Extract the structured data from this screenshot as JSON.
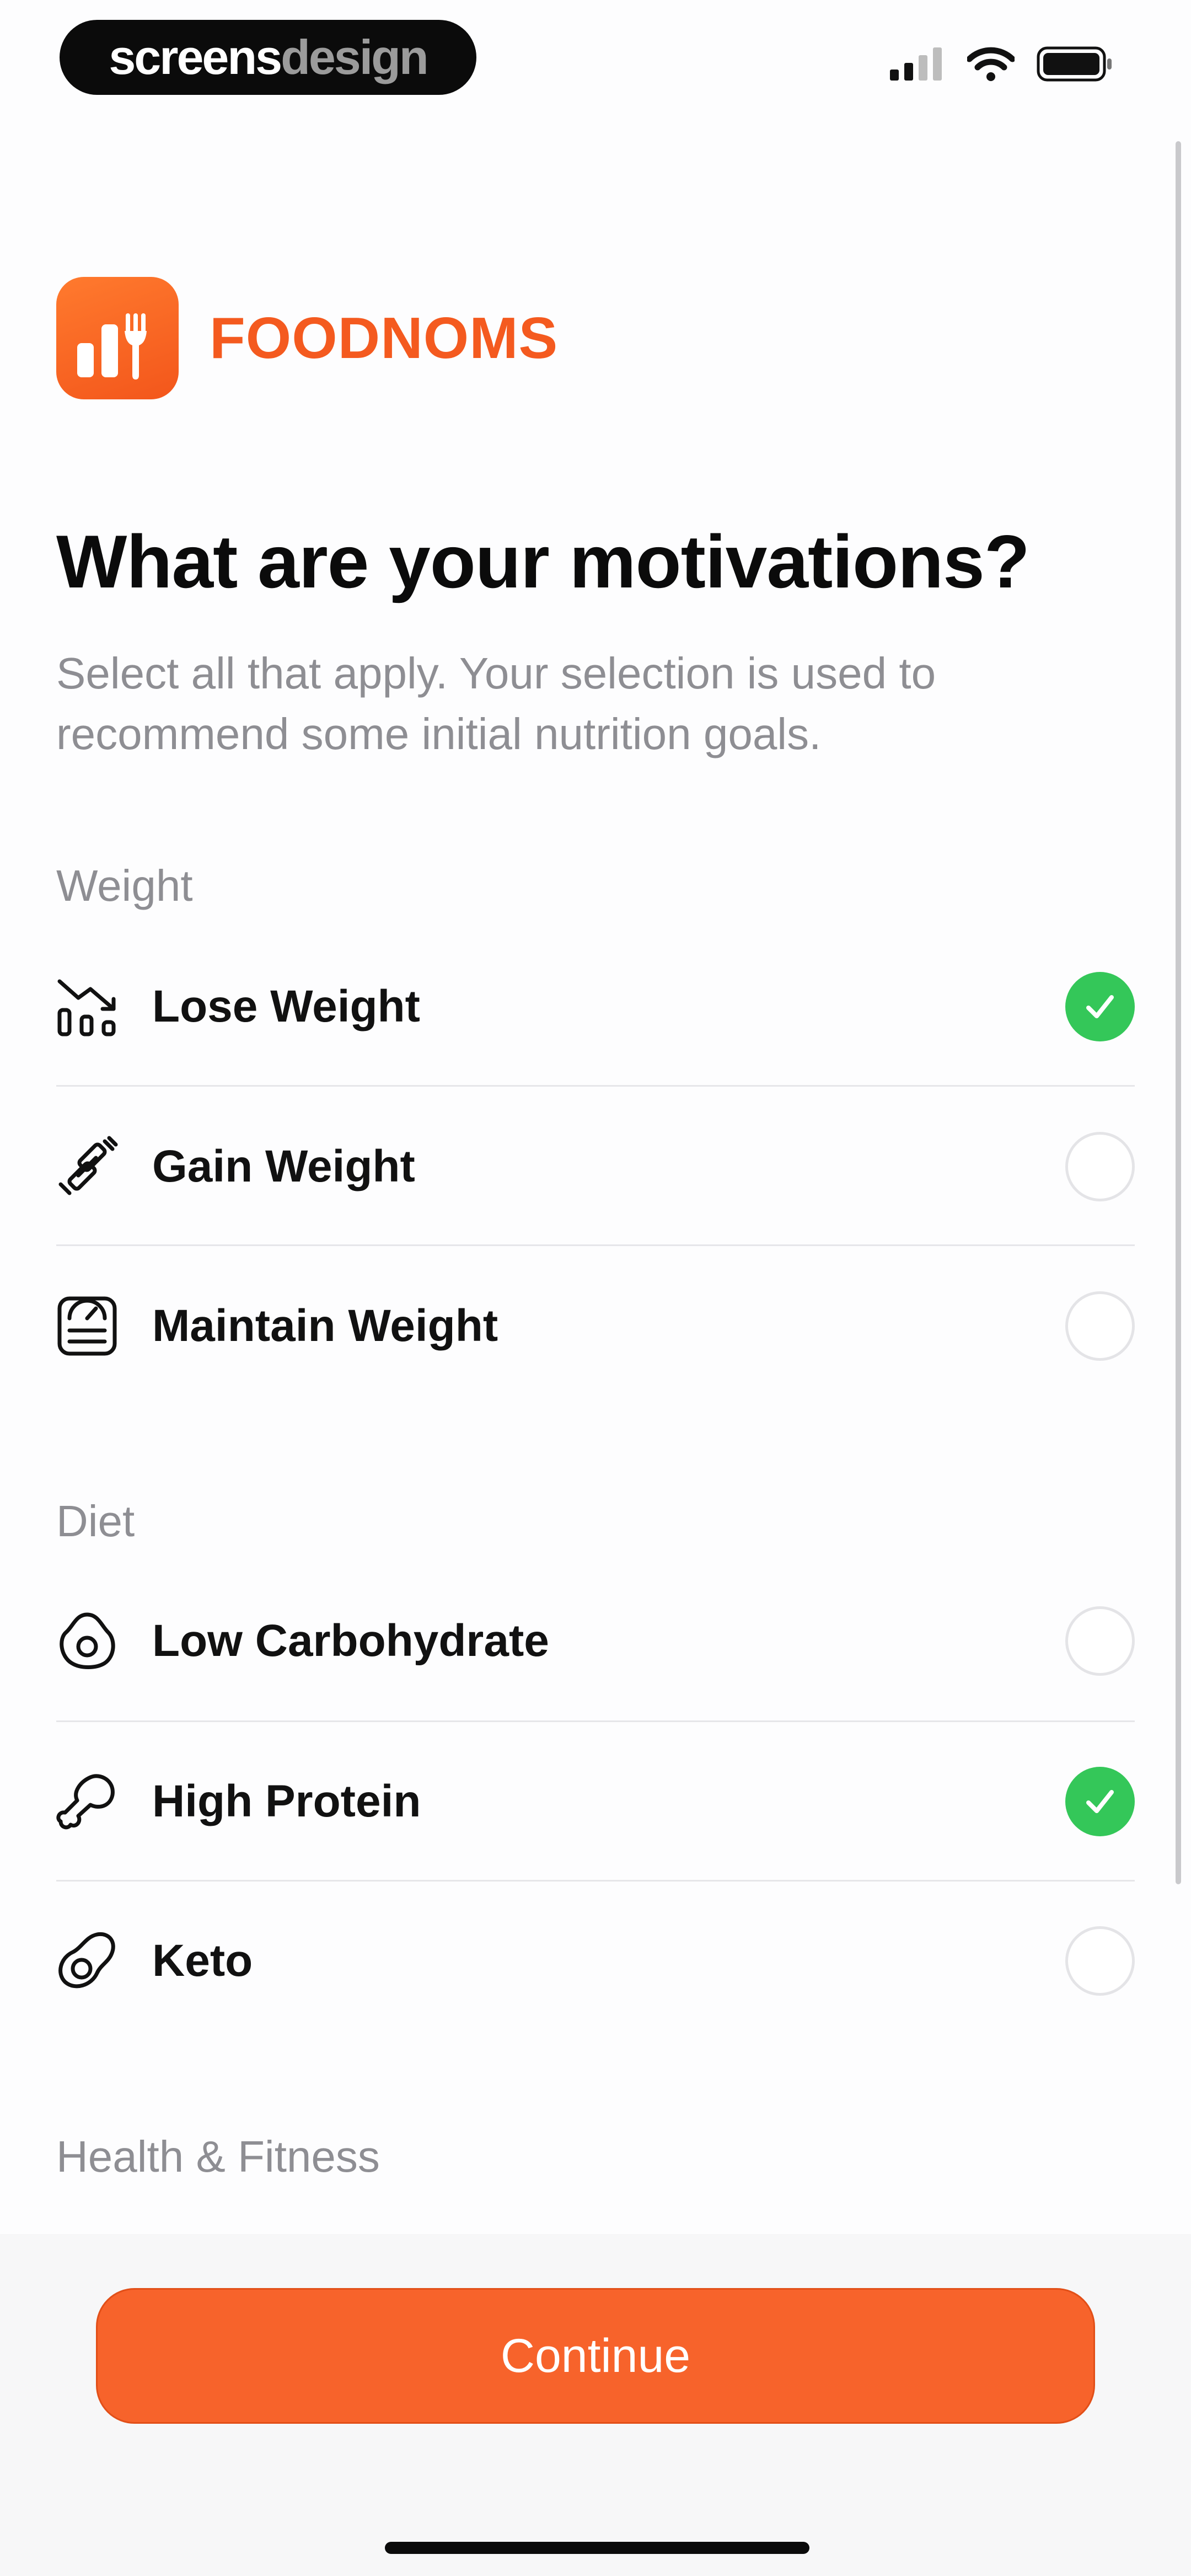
{
  "status_bar": {
    "brand_left": "screens",
    "brand_right": "design",
    "signal_icon": "cellular-signal-icon",
    "wifi_icon": "wifi-icon",
    "battery_icon": "battery-icon"
  },
  "app": {
    "logo_icon": "bar-chart-fork-icon",
    "name": "FOODNOMS",
    "brand_color": "#F45A1F"
  },
  "header": {
    "title": "What are your motivations?",
    "subtitle": "Select all that apply. Your selection is used to recommend some initial nutrition goals."
  },
  "sections": [
    {
      "label": "Weight",
      "items": [
        {
          "label": "Lose Weight",
          "icon": "chart-down-icon",
          "selected": true
        },
        {
          "label": "Gain Weight",
          "icon": "dumbbell-icon",
          "selected": false
        },
        {
          "label": "Maintain Weight",
          "icon": "scale-icon",
          "selected": false
        }
      ]
    },
    {
      "label": "Diet",
      "items": [
        {
          "label": "Low Carbohydrate",
          "icon": "bread-icon",
          "selected": false
        },
        {
          "label": "High Protein",
          "icon": "drumstick-icon",
          "selected": true
        },
        {
          "label": "Keto",
          "icon": "avocado-icon",
          "selected": false
        }
      ]
    },
    {
      "label": "Health & Fitness",
      "items": []
    }
  ],
  "footer": {
    "continue_label": "Continue",
    "accent_color": "#F7632B"
  },
  "colors": {
    "check_on": "#34C759",
    "muted_text": "#8E8E93"
  }
}
